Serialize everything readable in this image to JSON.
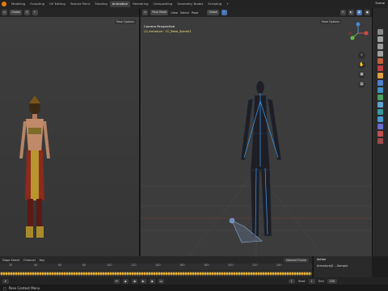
{
  "topbar": {
    "tabs": [
      "Modeling",
      "Sculpting",
      "UV Editing",
      "Texture Paint",
      "Shading",
      "Animation",
      "Rendering",
      "Compositing",
      "Geometry Nodes",
      "Scripting",
      "+"
    ],
    "scene": "Scene"
  },
  "left_viewport": {
    "orientation": "Global",
    "pose_options": "Pose Options"
  },
  "right_viewport": {
    "mode": "Pose Mode",
    "menus": [
      "View",
      "Select",
      "Pose"
    ],
    "orientation": "Global",
    "camera_title": "Camera Perspective",
    "camera_sub": "(1) Armature : CC_Base_Spine01",
    "pose_options": "Pose Options"
  },
  "timeline": {
    "menus": [
      "Dope Sheet",
      "Channel",
      "Key"
    ],
    "ticks": [
      "20",
      "40",
      "60",
      "80",
      "100",
      "120",
      "140",
      "160",
      "180",
      "200",
      "220",
      "240"
    ],
    "current_frame": "1",
    "start_label": "Start",
    "start_value": "1",
    "end_label": "End",
    "end_value": "250",
    "keying": "Nearest Frame"
  },
  "action_panel": {
    "title": "Action",
    "action_name": "Armature|0 ...Sample"
  },
  "statusbar": {
    "text": "Pose Context Menu"
  },
  "colors": {
    "accent": "#e87d0d",
    "selected": "#4772b3",
    "armature_highlight": "#f5e07a",
    "bone_blue": "#3aa0ff"
  }
}
